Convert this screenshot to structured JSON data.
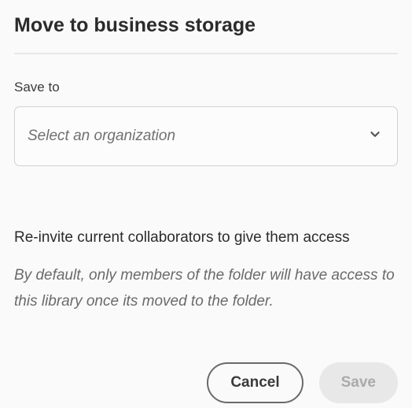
{
  "dialog": {
    "title": "Move to business storage",
    "save_to_label": "Save to",
    "select_placeholder": "Select an organization",
    "reinvite_heading": "Re-invite current collaborators to give them access",
    "helper_text": "By default, only members of the folder will have access to this library once its moved to the folder.",
    "buttons": {
      "cancel": "Cancel",
      "save": "Save"
    }
  }
}
